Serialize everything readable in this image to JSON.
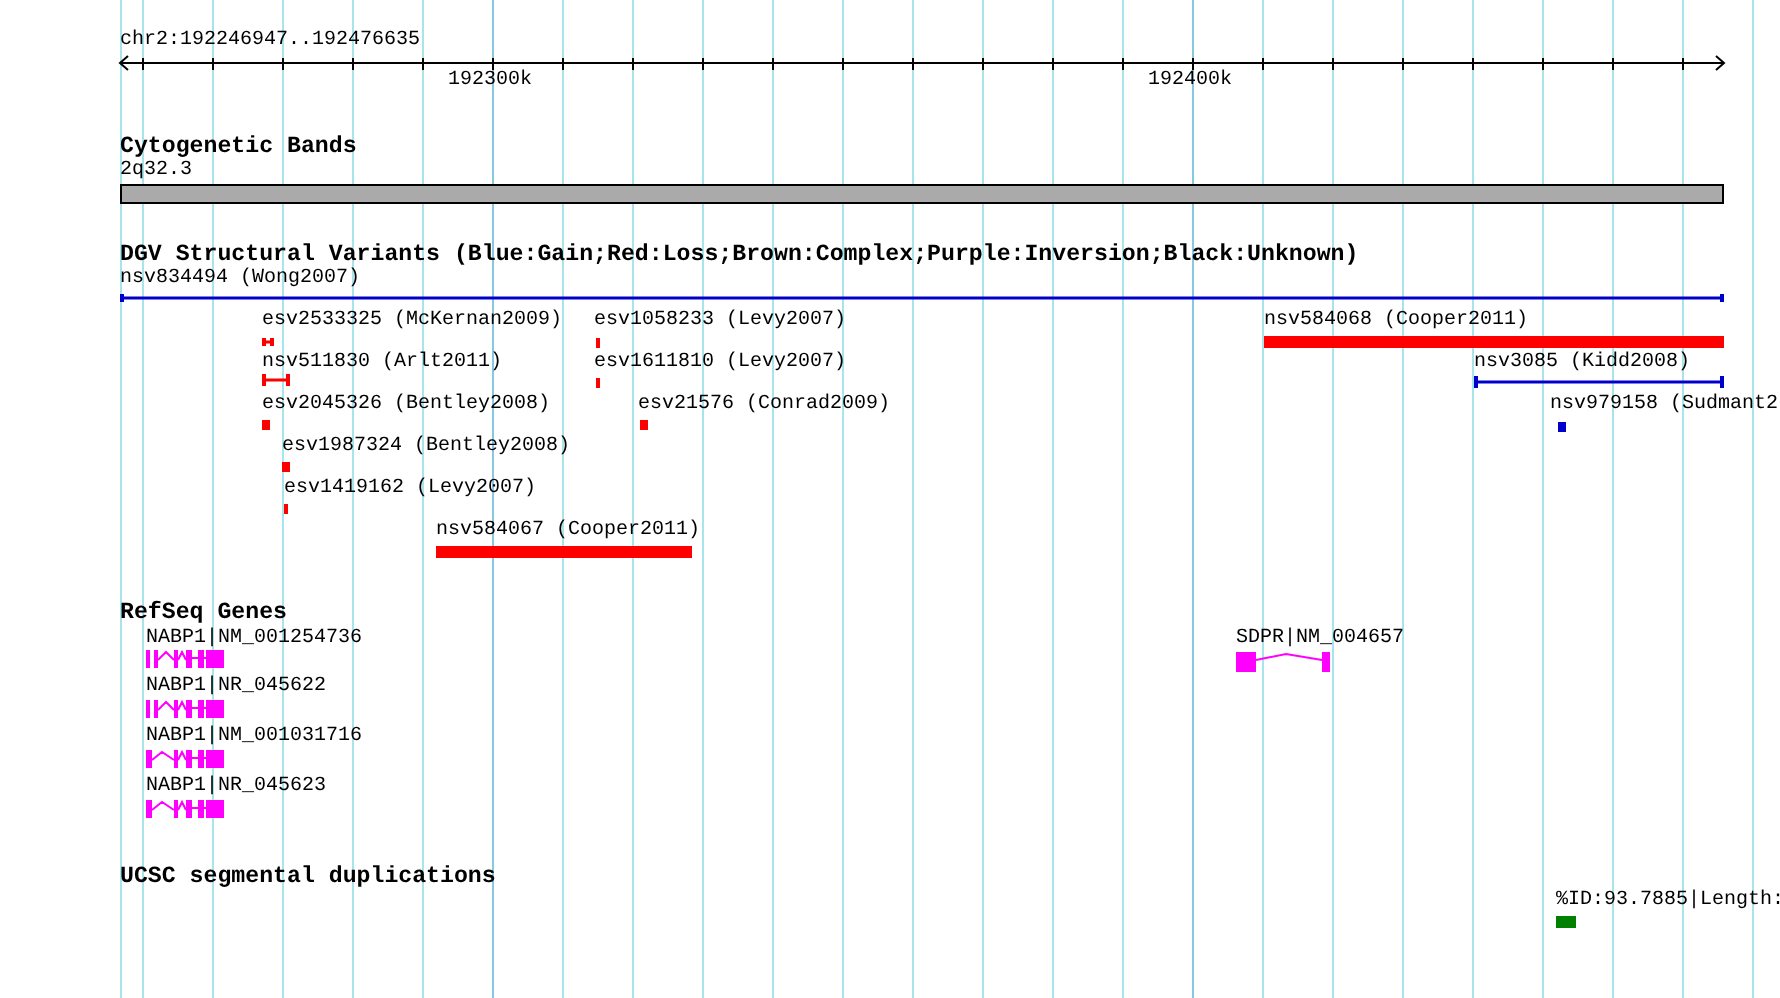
{
  "ruler": {
    "position": "chr2:192246947..192476635",
    "ticks": [
      "192300k",
      "192400k"
    ]
  },
  "tracks": [
    {
      "kind": "bands",
      "title": "Cytogenetic Bands",
      "features": [
        {
          "label": "2q32.3"
        }
      ]
    },
    {
      "kind": "variants",
      "title": "DGV Structural Variants (Blue:Gain;Red:Loss;Brown:Complex;Purple:Inversion;Black:Unknown)",
      "features": [
        {
          "label": "nsv834494 (Wong2007)",
          "color": "#0000cc"
        },
        {
          "label": "esv2533325 (McKernan2009)",
          "color": "#ff0000"
        },
        {
          "label": "esv1058233 (Levy2007)",
          "color": "#ff0000"
        },
        {
          "label": "nsv584068 (Cooper2011)",
          "color": "#ff0000"
        },
        {
          "label": "nsv511830 (Arlt2011)",
          "color": "#ff0000"
        },
        {
          "label": "esv1611810 (Levy2007)",
          "color": "#ff0000"
        },
        {
          "label": "nsv3085 (Kidd2008)",
          "color": "#0000cc"
        },
        {
          "label": "esv2045326 (Bentley2008)",
          "color": "#ff0000"
        },
        {
          "label": "esv21576 (Conrad2009)",
          "color": "#ff0000"
        },
        {
          "label": "nsv979158 (Sudmant2",
          "color": "#0000cc"
        },
        {
          "label": "esv1987324 (Bentley2008)",
          "color": "#ff0000"
        },
        {
          "label": "esv1419162 (Levy2007)",
          "color": "#ff0000"
        },
        {
          "label": "nsv584067 (Cooper2011)",
          "color": "#ff0000"
        }
      ]
    },
    {
      "kind": "genes",
      "title": "RefSeq Genes",
      "features": [
        {
          "label": "NABP1|NM_001254736"
        },
        {
          "label": "NABP1|NR_045622"
        },
        {
          "label": "NABP1|NM_001031716"
        },
        {
          "label": "NABP1|NR_045623"
        },
        {
          "label": "SDPR|NM_004657"
        }
      ]
    },
    {
      "kind": "duplications",
      "title": "UCSC segmental duplications",
      "features": [
        {
          "label": "%ID:93.7885|Length:"
        }
      ]
    }
  ]
}
